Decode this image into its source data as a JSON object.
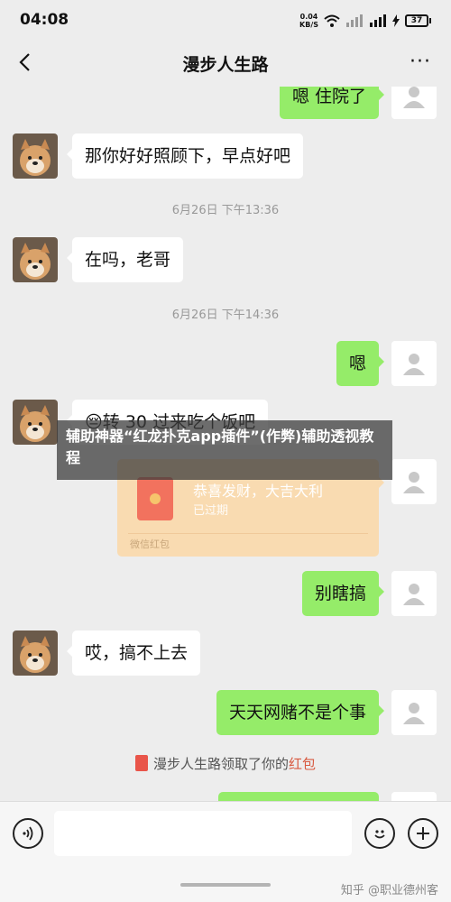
{
  "status_bar": {
    "time": "04:08",
    "net_speed_value": "0.04",
    "net_speed_unit": "KB/S",
    "battery": "37"
  },
  "nav": {
    "title": "漫步人生路",
    "back_icon": "chevron-left-icon",
    "more_label": "···"
  },
  "messages": [
    {
      "side": "out",
      "text": "嗯  住院了"
    },
    {
      "side": "in",
      "text": "那你好好照顾下，早点好吧"
    },
    {
      "type": "time",
      "text": "6月26日 下午13:36"
    },
    {
      "side": "in",
      "text": "在吗，老哥"
    },
    {
      "type": "time",
      "text": "6月26日 下午14:36"
    },
    {
      "side": "out",
      "text": "嗯"
    },
    {
      "side": "in",
      "text": "😔转 30 过来吃个饭吧"
    },
    {
      "type": "redpacket",
      "title": "恭喜发财，大吉大利",
      "status": "已过期",
      "footer": "微信红包"
    },
    {
      "side": "out",
      "text": "别瞎搞"
    },
    {
      "side": "in",
      "text": "哎，搞不上去"
    },
    {
      "side": "out",
      "text": "天天网赌不是个事"
    },
    {
      "type": "system",
      "prefix": "漫步人生路领取了你的",
      "link": "红包"
    }
  ],
  "overlay_text": "辅助神器“红龙扑克app插件”(作弊)辅助透视教程",
  "input_bar": {
    "voice_icon": "voice-icon",
    "emoji_icon": "emoji-icon",
    "plus_icon": "plus-icon"
  },
  "watermark": "知乎 @职业德州客",
  "colors": {
    "background": "#ededed",
    "outgoing_bubble": "#95ec69",
    "incoming_bubble": "#ffffff",
    "redpacket": "#f9dbb1"
  }
}
